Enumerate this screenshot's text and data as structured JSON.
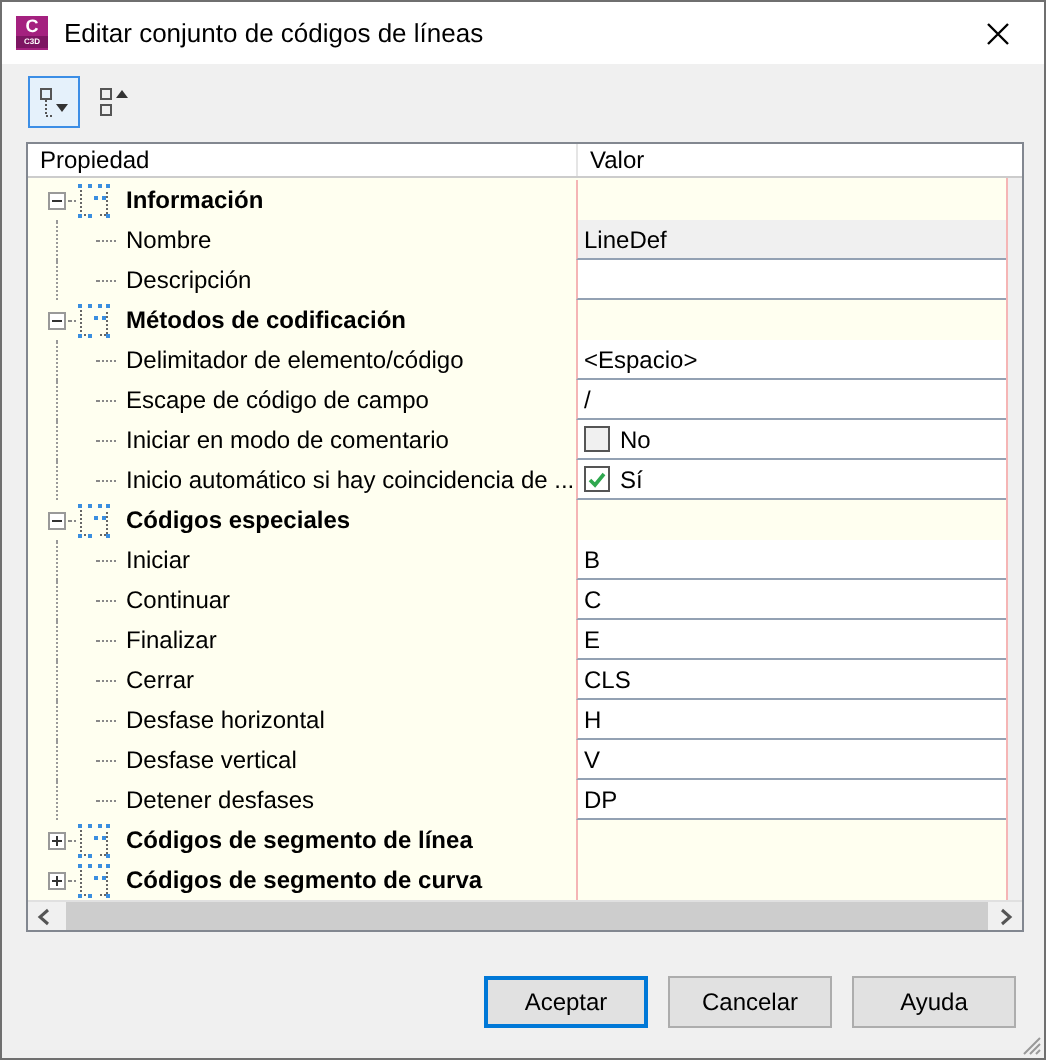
{
  "window": {
    "title": "Editar conjunto de códigos de líneas",
    "app_icon": {
      "letter": "C",
      "caption": "C3D"
    }
  },
  "toolbar": [
    {
      "kind": "expand",
      "selected": true
    },
    {
      "kind": "collapse",
      "selected": false
    }
  ],
  "grid": {
    "columns": [
      "Propiedad",
      "Valor"
    ],
    "groups": [
      {
        "label": "Información",
        "expanded": true,
        "children": [
          {
            "label": "Nombre",
            "kind": "text",
            "value": "LineDef",
            "readonly": true
          },
          {
            "label": "Descripción",
            "kind": "text",
            "readonly": false
          }
        ]
      },
      {
        "label": "Métodos de codificación",
        "expanded": true,
        "children": [
          {
            "label": "Delimitador de elemento/código",
            "kind": "text",
            "value": "<Espacio>",
            "readonly": false
          },
          {
            "label": "Escape de código de campo",
            "kind": "text",
            "value": "/",
            "readonly": false
          },
          {
            "label": "Iniciar en modo de comentario",
            "kind": "checkbox",
            "checked": false,
            "value": "No"
          },
          {
            "label": "Inicio automático si hay coincidencia de ...",
            "kind": "checkbox",
            "checked": true,
            "value": "Sí"
          }
        ]
      },
      {
        "label": "Códigos especiales",
        "expanded": true,
        "children": [
          {
            "label": "Iniciar",
            "kind": "text",
            "value": "B",
            "readonly": false
          },
          {
            "label": "Continuar",
            "kind": "text",
            "value": "C",
            "readonly": false
          },
          {
            "label": "Finalizar",
            "kind": "text",
            "value": "E",
            "readonly": false
          },
          {
            "label": "Cerrar",
            "kind": "text",
            "value": "CLS",
            "readonly": false
          },
          {
            "label": "Desfase horizontal",
            "kind": "text",
            "value": "H",
            "readonly": false
          },
          {
            "label": "Desfase vertical",
            "kind": "text",
            "value": "V",
            "readonly": false
          },
          {
            "label": "Detener desfases",
            "kind": "text",
            "value": "DP",
            "readonly": false
          }
        ]
      },
      {
        "label": "Códigos de segmento de línea",
        "expanded": false
      },
      {
        "label": "Códigos de segmento de curva",
        "expanded": false
      }
    ]
  },
  "buttons": [
    {
      "label": "Aceptar",
      "default": true
    },
    {
      "label": "Cancelar",
      "default": false
    },
    {
      "label": "Ayuda",
      "default": false
    }
  ]
}
